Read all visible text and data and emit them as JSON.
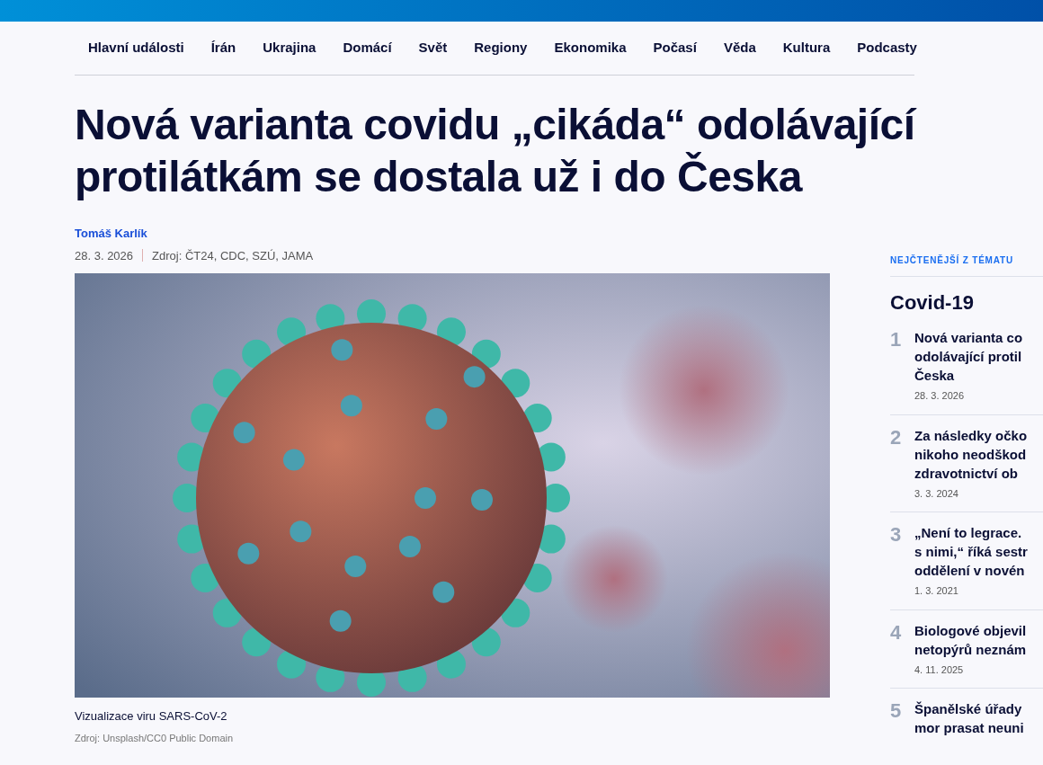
{
  "nav": [
    {
      "label": "Hlavní události"
    },
    {
      "label": "Írán"
    },
    {
      "label": "Ukrajina"
    },
    {
      "label": "Domácí"
    },
    {
      "label": "Svět"
    },
    {
      "label": "Regiony"
    },
    {
      "label": "Ekonomika"
    },
    {
      "label": "Počasí"
    },
    {
      "label": "Věda"
    },
    {
      "label": "Kultura"
    },
    {
      "label": "Podcasty"
    }
  ],
  "article": {
    "title": "Nová varianta covidu „cikáda“ odolávající protilátkám se dostala už i do Česka",
    "author": "Tomáš Karlík",
    "date": "28. 3. 2026",
    "source": "Zdroj: ČT24, CDC, SZÚ, JAMA",
    "caption": "Vizualizace viru SARS-CoV-2",
    "photo_credit": "Zdroj: Unsplash/CC0 Public Domain"
  },
  "sidebar": {
    "eyebrow": "NEJČTENĚJŠÍ Z TÉMATU",
    "heading": "Covid-19",
    "items": [
      {
        "rank": "1",
        "lines": [
          "Nová varianta co",
          "odolávající protil",
          "Česka"
        ],
        "date": "28. 3. 2026"
      },
      {
        "rank": "2",
        "lines": [
          "Za následky očko",
          "nikoho neodškod",
          "zdravotnictví ob"
        ],
        "date": "3. 3. 2024"
      },
      {
        "rank": "3",
        "lines": [
          "„Není to legrace.",
          "s nimi,“ říká sestr",
          "oddělení v novén"
        ],
        "date": "1. 3. 2021"
      },
      {
        "rank": "4",
        "lines": [
          "Biologové objevil",
          "netopýrů neznám"
        ],
        "date": "4. 11. 2025"
      },
      {
        "rank": "5",
        "lines": [
          "Španělské úřady",
          "mor prasat neuni"
        ]
      }
    ]
  }
}
